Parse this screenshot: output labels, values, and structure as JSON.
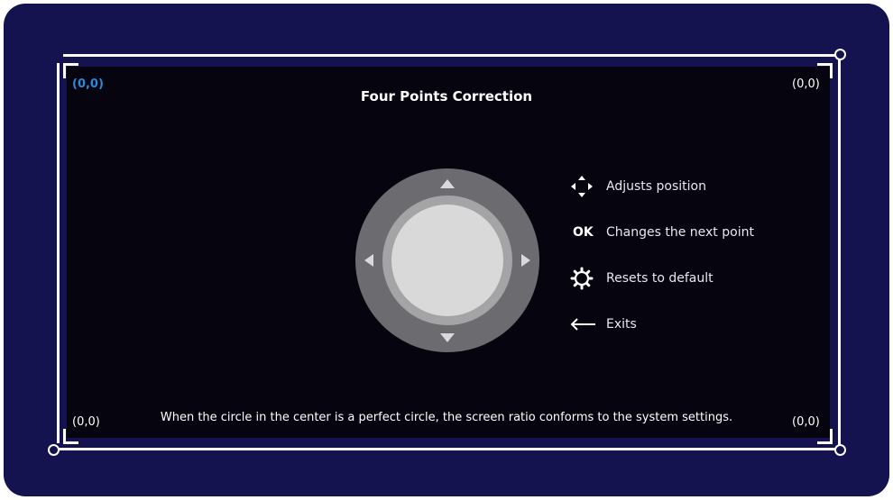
{
  "title": "Four Points Correction",
  "corners": {
    "top_left": "(0,0)",
    "top_right": "(0,0)",
    "bottom_left": "(0,0)",
    "bottom_right": "(0,0)"
  },
  "active_corner": "top_left",
  "legend": [
    {
      "icon": "four-direction-arrows-icon",
      "label": "Adjusts position"
    },
    {
      "icon": "ok-key",
      "key_text": "OK",
      "label": "Changes the next point"
    },
    {
      "icon": "gear-icon",
      "label": "Resets to default"
    },
    {
      "icon": "back-arrow-icon",
      "label": "Exits"
    }
  ],
  "hint": "When the circle in the center is a perfect circle, the screen ratio conforms to the system settings.",
  "colors": {
    "frame_background": "#14124f",
    "screen_background": "#05040f",
    "active_coordinate": "#2b8bd8",
    "joystick_outer": "#6b6b70",
    "joystick_ring": "#a4a4a6",
    "joystick_center": "#d9d9d9"
  }
}
